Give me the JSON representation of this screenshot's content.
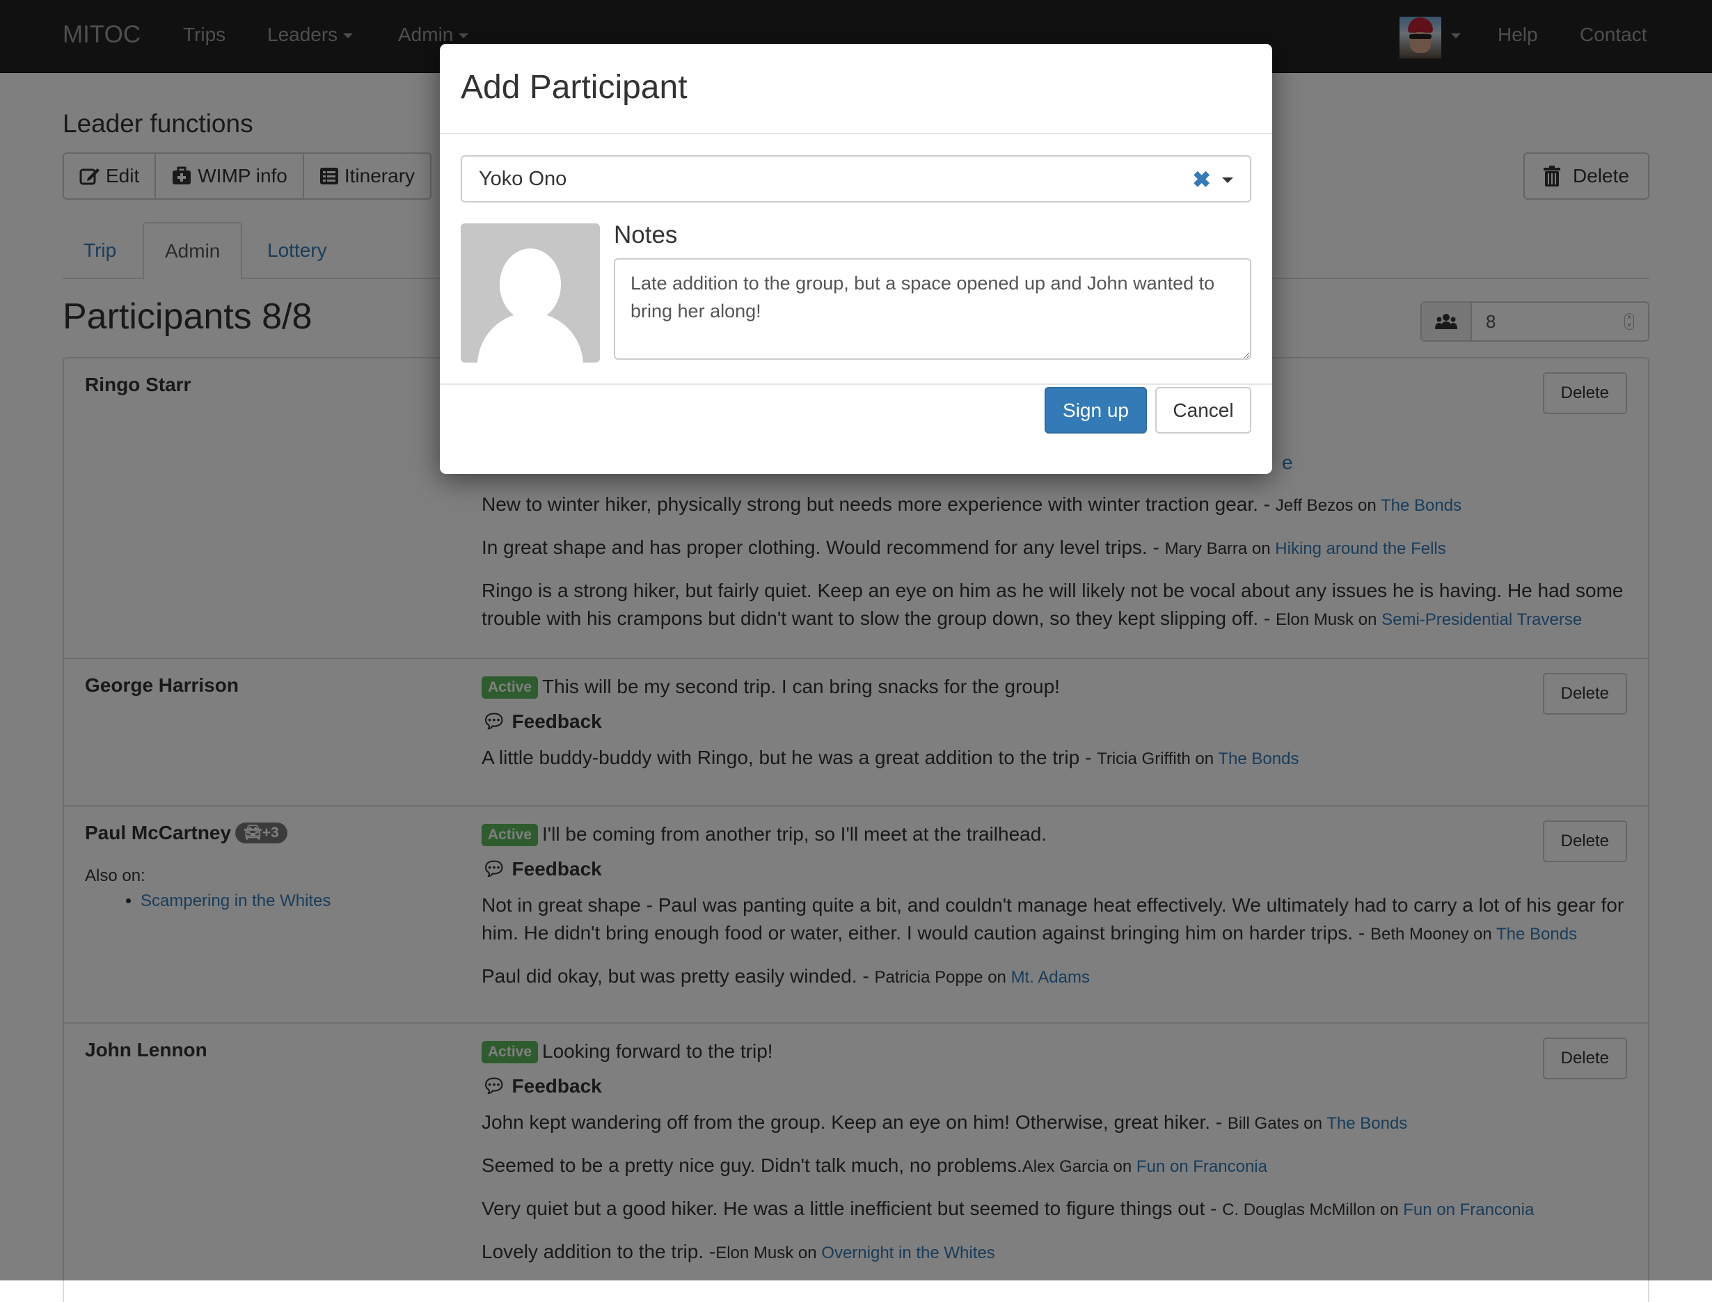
{
  "navbar": {
    "brand": "MITOC",
    "items": [
      {
        "label": "Trips",
        "dropdown": false
      },
      {
        "label": "Leaders",
        "dropdown": true
      },
      {
        "label": "Admin",
        "dropdown": true
      }
    ],
    "right_items": [
      {
        "label": "Help"
      },
      {
        "label": "Contact"
      }
    ],
    "avatar_icon": "user-avatar-photo"
  },
  "leader_functions": {
    "title": "Leader functions",
    "buttons": [
      {
        "label": "Edit",
        "icon": "edit-icon"
      },
      {
        "label": "WIMP info",
        "icon": "medkit-icon"
      },
      {
        "label": "Itinerary",
        "icon": "list-icon"
      }
    ],
    "delete_label": "Delete",
    "delete_icon": "trash-icon"
  },
  "tabs": [
    {
      "label": "Trip",
      "active": false
    },
    {
      "label": "Admin",
      "active": true
    },
    {
      "label": "Lottery",
      "active": false
    }
  ],
  "participants": {
    "title": "Participants 8/8",
    "capacity_icon": "users-icon",
    "capacity_value": "8",
    "rows": [
      {
        "name": "Ringo Starr",
        "hidden_link_tail": "e",
        "feedback": [
          {
            "text": "New to winter hiker, physically strong but needs more experience with winter traction gear. - ",
            "author": "Jeff Bezos",
            "on": " on ",
            "trip": "The Bonds"
          },
          {
            "text": "In great shape and has proper clothing. Would recommend for any level trips. - ",
            "author": "Mary Barra",
            "on": " on ",
            "trip": "Hiking around the Fells"
          },
          {
            "text": "Ringo is a strong hiker, but fairly quiet. Keep an eye on him as he will likely not be vocal about any issues he is having. He had some trouble with his crampons but didn't want to slow the group down, so they kept slipping off. - ",
            "author": "Elon Musk",
            "on": " on ",
            "trip": "Semi-Presidential Traverse"
          }
        ],
        "delete_label": "Delete"
      },
      {
        "name": "George Harrison",
        "status": "Active",
        "notes": "This will be my second trip. I can bring snacks for the group!",
        "feedback_heading": "Feedback",
        "feedback": [
          {
            "text": "A little buddy-buddy with Ringo, but he was a great addition to the trip - ",
            "author": "Tricia Griffith",
            "on": " on ",
            "trip": "The Bonds"
          }
        ],
        "delete_label": "Delete"
      },
      {
        "name": "Paul McCartney",
        "car_badge": "+3",
        "also_on_label": "Also on:",
        "also_on": [
          "Scampering in the Whites"
        ],
        "status": "Active",
        "notes": "I'll be coming from another trip, so I'll meet at the trailhead.",
        "feedback_heading": "Feedback",
        "feedback": [
          {
            "text": "Not in great shape - Paul was panting quite a bit, and couldn't manage heat effectively. We ultimately had to carry a lot of his gear for him. He didn't bring enough food or water, either. I would caution against bringing him on harder trips. - ",
            "author": "Beth Mooney",
            "on": " on ",
            "trip": "The Bonds"
          },
          {
            "text": "Paul did okay, but was pretty easily winded. - ",
            "author": "Patricia Poppe",
            "on": " on ",
            "trip": "Mt. Adams"
          }
        ],
        "delete_label": "Delete"
      },
      {
        "name": "John Lennon",
        "status": "Active",
        "notes": "Looking forward to the trip!",
        "feedback_heading": "Feedback",
        "feedback": [
          {
            "text": "John kept wandering off from the group. Keep an eye on him! Otherwise, great hiker. - ",
            "author": "Bill Gates",
            "on": " on ",
            "trip": "The Bonds"
          },
          {
            "text": "Seemed to be a pretty nice guy. Didn't talk much, no problems.",
            "author": "Alex Garcia",
            "on": " on ",
            "trip": "Fun on Franconia"
          },
          {
            "text": "Very quiet but a good hiker. He was a little inefficient but seemed to figure things out - ",
            "author": "C. Douglas McMillon",
            "on": " on ",
            "trip": "Fun on Franconia"
          },
          {
            "text": "Lovely addition to the trip. -",
            "author": "Elon Musk",
            "on": " on ",
            "trip": "Overnight in the Whites"
          }
        ],
        "delete_label": "Delete"
      }
    ]
  },
  "modal": {
    "title": "Add Participant",
    "selected_participant": "Yoko Ono",
    "clear_icon": "clear-x-icon",
    "notes_label": "Notes",
    "notes_value": "Late addition to the group, but a space opened up and John wanted to bring her along!",
    "signup_label": "Sign up",
    "cancel_label": "Cancel"
  },
  "colors": {
    "link": "#337ab7",
    "active_label": "#5cb85c",
    "primary_button": "#337ab7",
    "navbar": "#222222"
  }
}
